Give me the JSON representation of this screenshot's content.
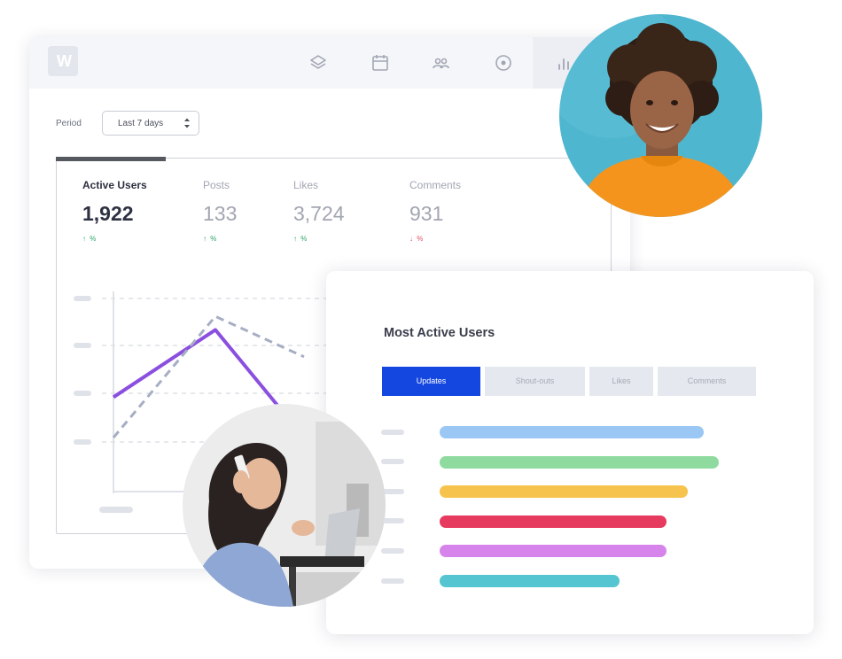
{
  "app": {
    "logo_text": "W"
  },
  "nav": [
    {
      "name": "layers-icon"
    },
    {
      "name": "calendar-icon"
    },
    {
      "name": "users-icon"
    },
    {
      "name": "target-icon"
    },
    {
      "name": "bar-chart-icon"
    }
  ],
  "filter": {
    "label": "Period",
    "selected": "Last 7 days"
  },
  "stats": [
    {
      "title": "Active Users",
      "value": "1,922",
      "trend": "↑ %",
      "direction": "up"
    },
    {
      "title": "Posts",
      "value": "133",
      "trend": "↑ %",
      "direction": "up"
    },
    {
      "title": "Likes",
      "value": "3,724",
      "trend": "↑ %",
      "direction": "up"
    },
    {
      "title": "Comments",
      "value": "931",
      "trend": "↓ %",
      "direction": "down"
    }
  ],
  "most_active": {
    "title": "Most Active Users",
    "tabs": [
      "Updates",
      "Shout-outs",
      "Likes",
      "Comments"
    ],
    "active_tab": "Updates"
  },
  "chart_data": [
    {
      "type": "line",
      "series": [
        {
          "style": "solid",
          "color": "#8b4fe0",
          "values": [
            0.3,
            0.8,
            0.0
          ]
        },
        {
          "style": "dashed",
          "color": "#a7aec3",
          "values": [
            0.0,
            0.9,
            0.6
          ]
        }
      ]
    },
    {
      "type": "bar",
      "orientation": "horizontal",
      "values": [
        0.85,
        0.9,
        0.8,
        0.73,
        0.73,
        0.58
      ],
      "colors": [
        "#9bc7f5",
        "#8fdb9f",
        "#f6c34d",
        "#e73a5f",
        "#d783ec",
        "#55c5d1"
      ]
    }
  ],
  "colors": {
    "accent": "#1446e0",
    "line_primary": "#8b4fe0",
    "trend_up": "#2ea66a",
    "trend_down": "#e05365"
  }
}
